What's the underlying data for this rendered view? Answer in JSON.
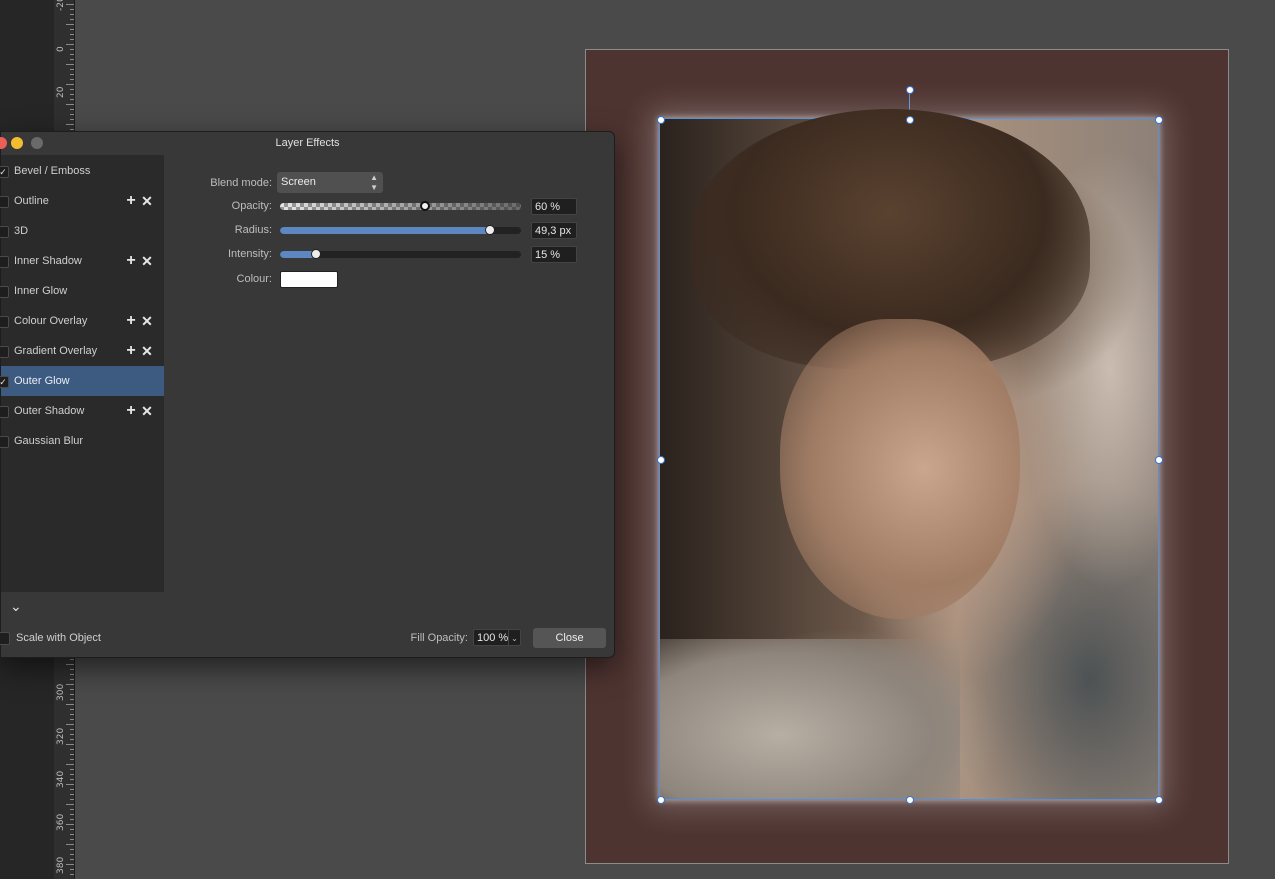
{
  "ruler": {
    "labels": [
      "-20",
      "0",
      "20",
      "300",
      "320",
      "340",
      "360",
      "380"
    ]
  },
  "dialog": {
    "title": "Layer Effects",
    "effects": [
      {
        "label": "Bevel / Emboss",
        "checked": true,
        "has_add": false
      },
      {
        "label": "Outline",
        "checked": false,
        "has_add": true
      },
      {
        "label": "3D",
        "checked": false,
        "has_add": false
      },
      {
        "label": "Inner Shadow",
        "checked": false,
        "has_add": true
      },
      {
        "label": "Inner Glow",
        "checked": false,
        "has_add": false
      },
      {
        "label": "Colour Overlay",
        "checked": false,
        "has_add": true
      },
      {
        "label": "Gradient Overlay",
        "checked": false,
        "has_add": true
      },
      {
        "label": "Outer Glow",
        "checked": true,
        "has_add": false,
        "selected": true
      },
      {
        "label": "Outer Shadow",
        "checked": false,
        "has_add": true
      },
      {
        "label": "Gaussian Blur",
        "checked": false,
        "has_add": false
      }
    ],
    "blend_mode": {
      "label": "Blend mode:",
      "value": "Screen"
    },
    "opacity": {
      "label": "Opacity:",
      "value": "60 %",
      "level": 0.6
    },
    "radius": {
      "label": "Radius:",
      "value": "49,3 px",
      "level": 0.87
    },
    "intensity": {
      "label": "Intensity:",
      "value": "15 %",
      "level": 0.15
    },
    "colour": {
      "label": "Colour:",
      "value": "#ffffff"
    },
    "scale_with_object": {
      "label": "Scale with Object",
      "checked": false
    },
    "fill_opacity": {
      "label": "Fill Opacity:",
      "value": "100 %"
    },
    "close_label": "Close"
  },
  "colors": {
    "accent": "#5d87c0",
    "selection": "#3d5a80",
    "document_bg": "#4e3431"
  }
}
